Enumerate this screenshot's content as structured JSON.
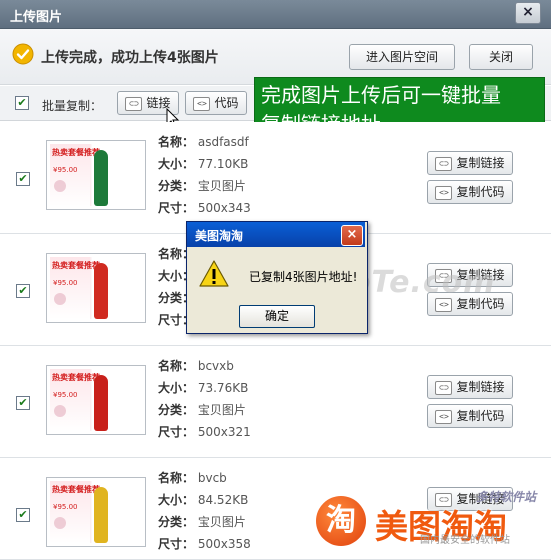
{
  "window": {
    "title": "上传图片",
    "close_glyph": "×"
  },
  "header": {
    "status_text": "上传完成，成功上传4张图片",
    "enter_space_label": "进入图片空间",
    "close_label": "关闭"
  },
  "batch": {
    "label": "批量复制：",
    "link_label": "链接",
    "code_label": "代码",
    "checked": true
  },
  "callout": {
    "line1": "完成图片上传后可一键批量",
    "line2": "复制链接地址"
  },
  "labels": {
    "name": "名称：",
    "size": "大小：",
    "category": "分类：",
    "dimensions": "尺寸：",
    "copy_link": "复制链接",
    "copy_code": "复制代码"
  },
  "thumbnail": {
    "headline": "热卖套餐推荐",
    "price": "¥95.00"
  },
  "images": [
    {
      "name": "asdfasdf",
      "size": "77.10KB",
      "category": "宝贝图片",
      "dimensions": "500x343",
      "checked": true,
      "outfit_color": "#1e7a3a"
    },
    {
      "name": "",
      "size": "",
      "category": "",
      "dimensions": "",
      "checked": true,
      "outfit_color": "#d02a20"
    },
    {
      "name": "bcvxb",
      "size": "73.76KB",
      "category": "宝贝图片",
      "dimensions": "500x321",
      "checked": true,
      "outfit_color": "#c8201a"
    },
    {
      "name": "bvcb",
      "size": "84.52KB",
      "category": "宝贝图片",
      "dimensions": "500x358",
      "checked": true,
      "outfit_color": "#e0b420"
    }
  ],
  "dialog": {
    "title": "美图淘淘",
    "message": "已复制4张图片地址!",
    "ok_label": "确定",
    "close_glyph": "×"
  },
  "overlays": {
    "watermark": "www.DuoTe.com",
    "logo_glyph": "淘",
    "logo_text": "美图淘淘",
    "site_name": "多特软件站",
    "site_tagline": "国内最安全的软件站"
  },
  "colors": {
    "callout_bg": "#0e8a1e",
    "logo_orange": "#f05a0f",
    "titlebar": "#6b7b8c"
  }
}
